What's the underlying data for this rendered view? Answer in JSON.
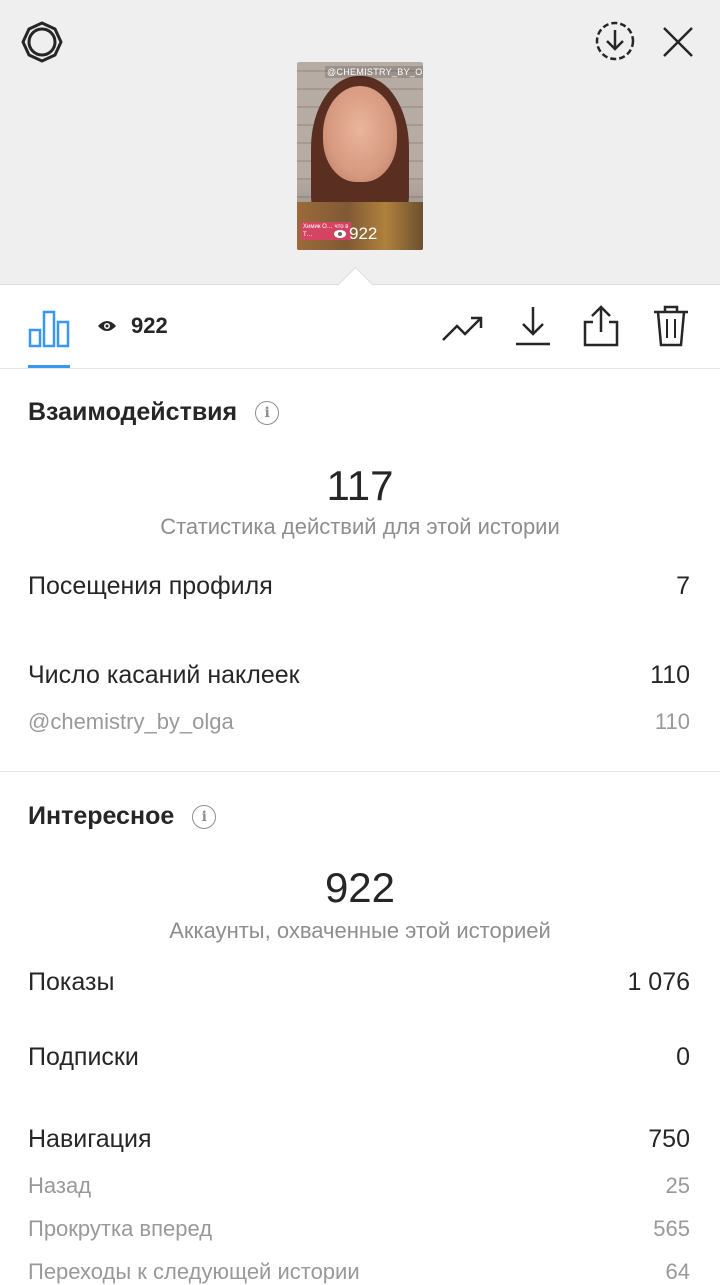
{
  "story": {
    "thumb_tag": "@CHEMISTRY_BY_OLGA",
    "thumb_caption": "Химик О… что в Т…",
    "thumb_views": "922"
  },
  "toolbar": {
    "views": "922"
  },
  "interactions": {
    "title": "Взаимодействия",
    "total": "117",
    "total_label": "Статистика действий для этой истории",
    "rows": [
      {
        "label": "Посещения профиля",
        "value": "7"
      },
      {
        "label": "Число касаний наклеек",
        "value": "110"
      }
    ],
    "sticker_sub": {
      "label": "@chemistry_by_olga",
      "value": "110"
    }
  },
  "discovery": {
    "title": "Интересное",
    "total": "922",
    "total_label": "Аккаунты, охваченные этой историей",
    "rows": [
      {
        "label": "Показы",
        "value": "1 076"
      },
      {
        "label": "Подписки",
        "value": "0"
      },
      {
        "label": "Навигация",
        "value": "750"
      }
    ],
    "nav_sub": [
      {
        "label": "Назад",
        "value": "25"
      },
      {
        "label": "Прокрутка вперед",
        "value": "565"
      },
      {
        "label": "Переходы к следующей истории",
        "value": "64"
      }
    ]
  },
  "colors": {
    "accent": "#3897f0",
    "text": "#262626",
    "muted": "#8e8e8e"
  },
  "icons": [
    "settings-gear-icon",
    "download-circle-icon",
    "close-icon",
    "bar-chart-icon",
    "eye-icon",
    "trending-icon",
    "download-icon",
    "share-icon",
    "trash-icon",
    "info-icon"
  ]
}
